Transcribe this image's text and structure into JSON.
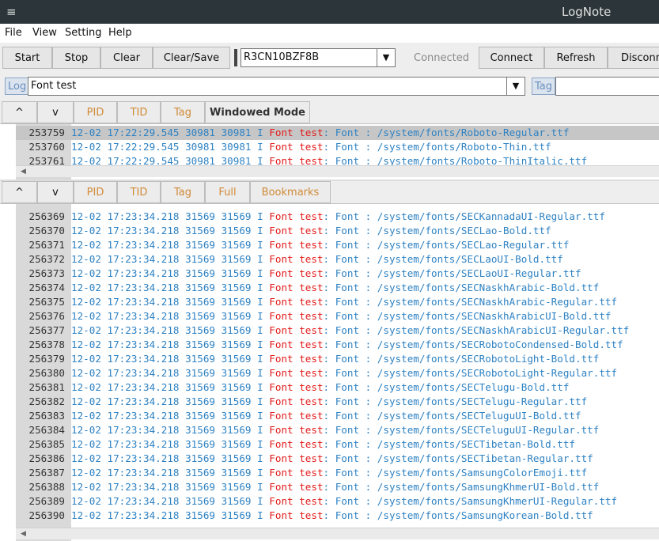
{
  "app": {
    "title": "LogNote",
    "menu_icon": "≡"
  },
  "menu": [
    "File",
    "View",
    "Setting",
    "Help"
  ],
  "toolbar": {
    "start": "Start",
    "stop": "Stop",
    "clear": "Clear",
    "clear_save": "Clear/Save",
    "device": "R3CN10BZF8B",
    "status": "Connected",
    "connect": "Connect",
    "refresh": "Refresh",
    "disconnect": "Disconn"
  },
  "filter": {
    "log_label": "Log",
    "log_value": "Font test",
    "tag_label": "Tag",
    "tag_value": ""
  },
  "top_panel": {
    "tabs": {
      "up": "^",
      "down": "v",
      "pid": "PID",
      "tid": "TID",
      "tag": "Tag",
      "mode": "Windowed Mode"
    },
    "rows": [
      {
        "num": "253759",
        "ts": "12-02 17:22:29.545",
        "pid": "30981",
        "tid": "30981",
        "lvl": "I",
        "tag": "Font test",
        "msg": ": Font : /system/fonts/Roboto-Regular.ttf",
        "selected": true
      },
      {
        "num": "253760",
        "ts": "12-02 17:22:29.545",
        "pid": "30981",
        "tid": "30981",
        "lvl": "I",
        "tag": "Font test",
        "msg": ": Font : /system/fonts/Roboto-Thin.ttf"
      },
      {
        "num": "253761",
        "ts": "12-02 17:22:29.545",
        "pid": "30981",
        "tid": "30981",
        "lvl": "I",
        "tag": "Font test",
        "msg": ": Font : /system/fonts/Roboto-ThinItalic.ttf"
      }
    ]
  },
  "bottom_panel": {
    "tabs": {
      "up": "^",
      "down": "v",
      "pid": "PID",
      "tid": "TID",
      "tag": "Tag",
      "full": "Full",
      "bookmarks": "Bookmarks"
    },
    "rows": [
      {
        "num": "256369",
        "ts": "12-02 17:23:34.218",
        "pid": "31569",
        "tid": "31569",
        "lvl": "I",
        "tag": "Font test",
        "msg": ": Font : /system/fonts/SECKannadaUI-Regular.ttf"
      },
      {
        "num": "256370",
        "ts": "12-02 17:23:34.218",
        "pid": "31569",
        "tid": "31569",
        "lvl": "I",
        "tag": "Font test",
        "msg": ": Font : /system/fonts/SECLao-Bold.ttf"
      },
      {
        "num": "256371",
        "ts": "12-02 17:23:34.218",
        "pid": "31569",
        "tid": "31569",
        "lvl": "I",
        "tag": "Font test",
        "msg": ": Font : /system/fonts/SECLao-Regular.ttf"
      },
      {
        "num": "256372",
        "ts": "12-02 17:23:34.218",
        "pid": "31569",
        "tid": "31569",
        "lvl": "I",
        "tag": "Font test",
        "msg": ": Font : /system/fonts/SECLaoUI-Bold.ttf"
      },
      {
        "num": "256373",
        "ts": "12-02 17:23:34.218",
        "pid": "31569",
        "tid": "31569",
        "lvl": "I",
        "tag": "Font test",
        "msg": ": Font : /system/fonts/SECLaoUI-Regular.ttf"
      },
      {
        "num": "256374",
        "ts": "12-02 17:23:34.218",
        "pid": "31569",
        "tid": "31569",
        "lvl": "I",
        "tag": "Font test",
        "msg": ": Font : /system/fonts/SECNaskhArabic-Bold.ttf"
      },
      {
        "num": "256375",
        "ts": "12-02 17:23:34.218",
        "pid": "31569",
        "tid": "31569",
        "lvl": "I",
        "tag": "Font test",
        "msg": ": Font : /system/fonts/SECNaskhArabic-Regular.ttf"
      },
      {
        "num": "256376",
        "ts": "12-02 17:23:34.218",
        "pid": "31569",
        "tid": "31569",
        "lvl": "I",
        "tag": "Font test",
        "msg": ": Font : /system/fonts/SECNaskhArabicUI-Bold.ttf"
      },
      {
        "num": "256377",
        "ts": "12-02 17:23:34.218",
        "pid": "31569",
        "tid": "31569",
        "lvl": "I",
        "tag": "Font test",
        "msg": ": Font : /system/fonts/SECNaskhArabicUI-Regular.ttf"
      },
      {
        "num": "256378",
        "ts": "12-02 17:23:34.218",
        "pid": "31569",
        "tid": "31569",
        "lvl": "I",
        "tag": "Font test",
        "msg": ": Font : /system/fonts/SECRobotoCondensed-Bold.ttf"
      },
      {
        "num": "256379",
        "ts": "12-02 17:23:34.218",
        "pid": "31569",
        "tid": "31569",
        "lvl": "I",
        "tag": "Font test",
        "msg": ": Font : /system/fonts/SECRobotoLight-Bold.ttf"
      },
      {
        "num": "256380",
        "ts": "12-02 17:23:34.218",
        "pid": "31569",
        "tid": "31569",
        "lvl": "I",
        "tag": "Font test",
        "msg": ": Font : /system/fonts/SECRobotoLight-Regular.ttf"
      },
      {
        "num": "256381",
        "ts": "12-02 17:23:34.218",
        "pid": "31569",
        "tid": "31569",
        "lvl": "I",
        "tag": "Font test",
        "msg": ": Font : /system/fonts/SECTelugu-Bold.ttf"
      },
      {
        "num": "256382",
        "ts": "12-02 17:23:34.218",
        "pid": "31569",
        "tid": "31569",
        "lvl": "I",
        "tag": "Font test",
        "msg": ": Font : /system/fonts/SECTelugu-Regular.ttf"
      },
      {
        "num": "256383",
        "ts": "12-02 17:23:34.218",
        "pid": "31569",
        "tid": "31569",
        "lvl": "I",
        "tag": "Font test",
        "msg": ": Font : /system/fonts/SECTeluguUI-Bold.ttf"
      },
      {
        "num": "256384",
        "ts": "12-02 17:23:34.218",
        "pid": "31569",
        "tid": "31569",
        "lvl": "I",
        "tag": "Font test",
        "msg": ": Font : /system/fonts/SECTeluguUI-Regular.ttf"
      },
      {
        "num": "256385",
        "ts": "12-02 17:23:34.218",
        "pid": "31569",
        "tid": "31569",
        "lvl": "I",
        "tag": "Font test",
        "msg": ": Font : /system/fonts/SECTibetan-Bold.ttf"
      },
      {
        "num": "256386",
        "ts": "12-02 17:23:34.218",
        "pid": "31569",
        "tid": "31569",
        "lvl": "I",
        "tag": "Font test",
        "msg": ": Font : /system/fonts/SECTibetan-Regular.ttf"
      },
      {
        "num": "256387",
        "ts": "12-02 17:23:34.218",
        "pid": "31569",
        "tid": "31569",
        "lvl": "I",
        "tag": "Font test",
        "msg": ": Font : /system/fonts/SamsungColorEmoji.ttf"
      },
      {
        "num": "256388",
        "ts": "12-02 17:23:34.218",
        "pid": "31569",
        "tid": "31569",
        "lvl": "I",
        "tag": "Font test",
        "msg": ": Font : /system/fonts/SamsungKhmerUI-Bold.ttf"
      },
      {
        "num": "256389",
        "ts": "12-02 17:23:34.218",
        "pid": "31569",
        "tid": "31569",
        "lvl": "I",
        "tag": "Font test",
        "msg": ": Font : /system/fonts/SamsungKhmerUI-Regular.ttf"
      },
      {
        "num": "256390",
        "ts": "12-02 17:23:34.218",
        "pid": "31569",
        "tid": "31569",
        "lvl": "I",
        "tag": "Font test",
        "msg": ": Font : /system/fonts/SamsungKorean-Bold.ttf"
      }
    ]
  }
}
